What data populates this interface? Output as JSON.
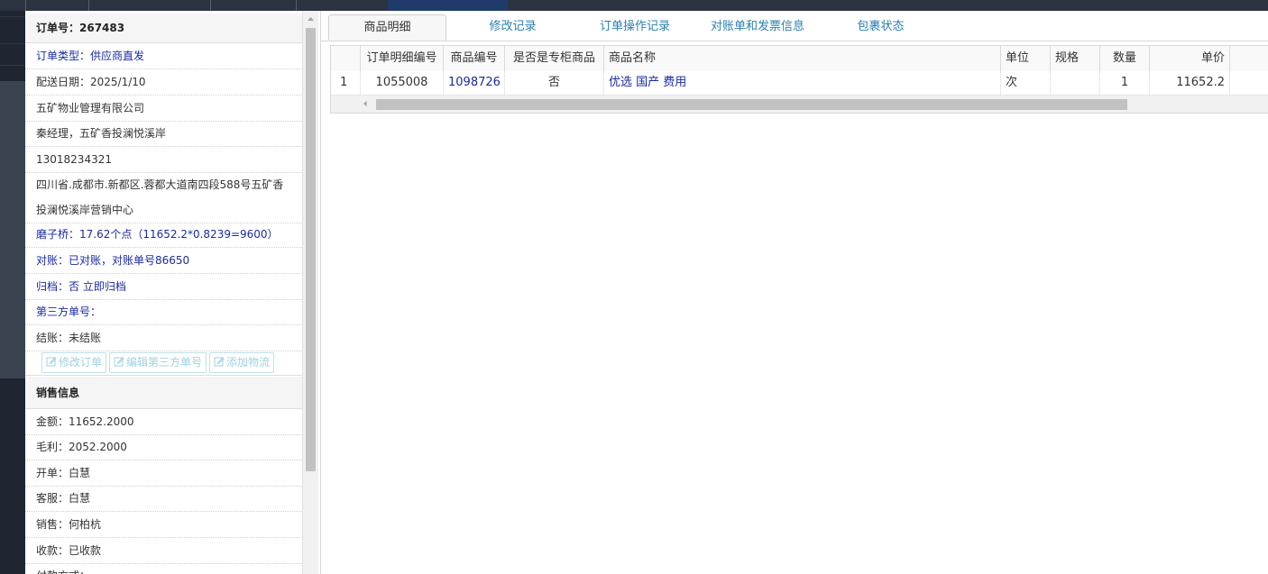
{
  "order": {
    "title": "订单号：267483",
    "type_label": "订单类型：",
    "type_value": "供应商直发",
    "delivery_date": "配送日期：2025/1/10",
    "company": "五矿物业管理有限公司",
    "contact": "秦经理，五矿香投澜悦溪岸",
    "phone": "13018234321",
    "address": "四川省.成都市.新都区.蓉都大道南四段588号五矿香投澜悦溪岸营销中心",
    "commission": "磨子桥：17.62个点（11652.2*0.8239=9600）",
    "reconcile": "对账：已对账，对账单号86650",
    "archive": "归档：否 立即归档",
    "third_party": "第三方单号：",
    "settle": "结账：未结账"
  },
  "actions": {
    "edit_order": "修改订单",
    "edit_third_party": "编辑第三方单号",
    "add_logistics": "添加物流"
  },
  "sales": {
    "title": "销售信息",
    "amount": "金额：11652.2000",
    "profit": "毛利：2052.2000",
    "opener": "开单：白慧",
    "service": "客服：白慧",
    "seller": "销售：何柏杭",
    "payment": "收款：已收款",
    "pay_method": "付款方式："
  },
  "tabs": [
    "商品明细",
    "修改记录",
    "订单操作记录",
    "对账单和发票信息",
    "包裹状态"
  ],
  "grid": {
    "headers": [
      "",
      "订单明细编号",
      "商品编号",
      "是否是专柜商品",
      "商品名称",
      "单位",
      "规格",
      "数量",
      "单价"
    ],
    "row": {
      "index": "1",
      "detail_id": "1055008",
      "product_id": "1098726",
      "is_counter": "否",
      "name": "优选 国产 费用",
      "unit": "次",
      "spec": "",
      "qty": "1",
      "price": "11652.2"
    }
  },
  "colors": {
    "link": "#1a2aa0",
    "tab_link": "#2a7fb0",
    "topbar": "#2b3341",
    "button_border": "#bfe0ea"
  }
}
